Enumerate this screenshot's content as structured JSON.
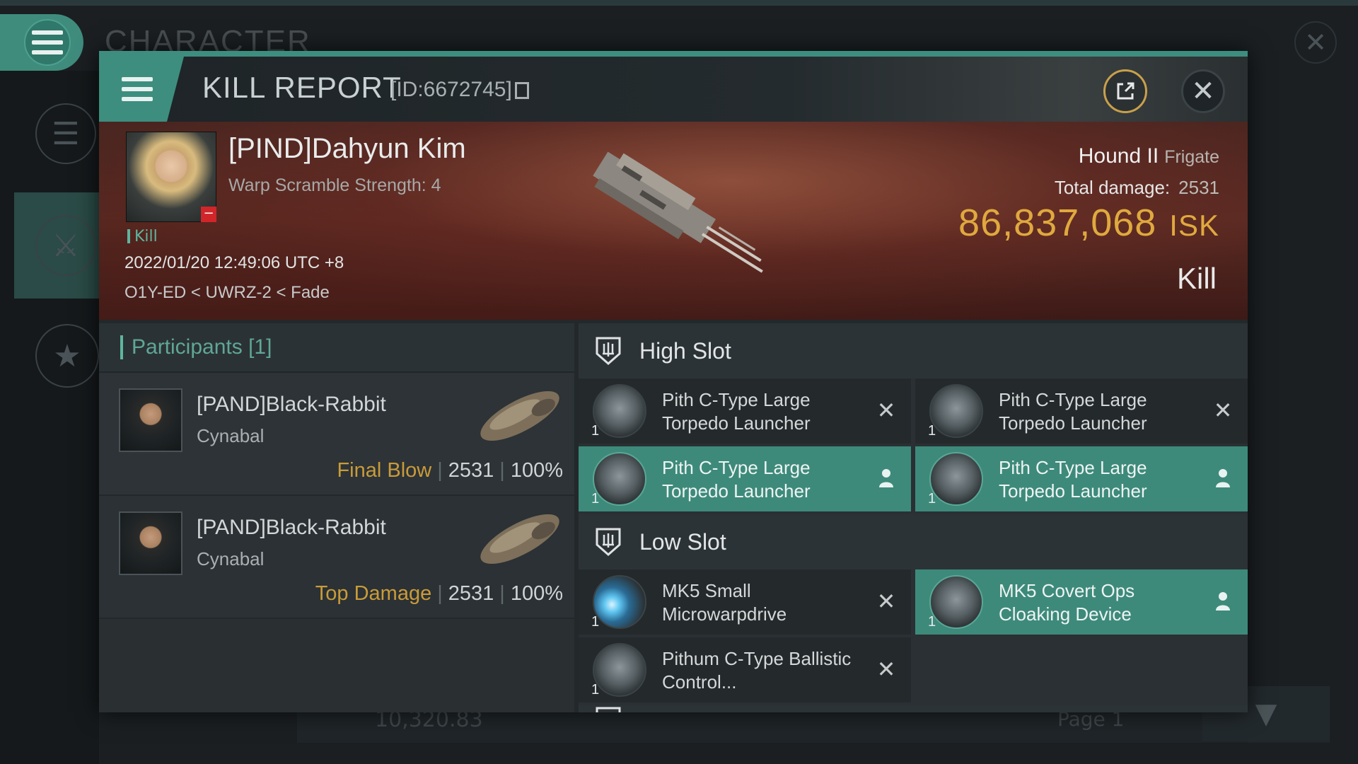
{
  "background": {
    "title": "CHARACTER",
    "bottom_value": "10,320.83",
    "page_label": "Page 1"
  },
  "modal": {
    "title": "KILL REPORT",
    "report_id": "[ID:6672745]"
  },
  "victim": {
    "name": "[PIND]Dahyun Kim",
    "subtitle": "Warp Scramble Strength: 4",
    "badge": "−",
    "kill_tag": "Kill",
    "datetime": "2022/01/20 12:49:06 UTC +8",
    "location": "O1Y-ED < UWRZ-2 < Fade",
    "ship_name": "Hound II",
    "ship_class": "Frigate",
    "total_damage_label": "Total damage:",
    "total_damage_value": "2531",
    "isk_value": "86,837,068",
    "isk_unit": "ISK",
    "result": "Kill"
  },
  "participants": {
    "header": "Participants [1]",
    "rows": [
      {
        "name": "[PAND]Black-Rabbit",
        "ship": "Cynabal",
        "role": "Final Blow",
        "damage": "2531",
        "percent": "100%"
      },
      {
        "name": "[PAND]Black-Rabbit",
        "ship": "Cynabal",
        "role": "Top Damage",
        "damage": "2531",
        "percent": "100%"
      }
    ]
  },
  "fitting": {
    "high_slot": {
      "title": "High Slot",
      "modules": [
        {
          "name": "Pith C-Type Large Torpedo Launcher",
          "qty": "1",
          "state": "destroyed"
        },
        {
          "name": "Pith C-Type Large Torpedo Launcher",
          "qty": "1",
          "state": "destroyed"
        },
        {
          "name": "Pith C-Type Large Torpedo Launcher",
          "qty": "1",
          "state": "dropped"
        },
        {
          "name": "Pith C-Type Large Torpedo Launcher",
          "qty": "1",
          "state": "dropped"
        }
      ]
    },
    "low_slot": {
      "title": "Low Slot",
      "modules": [
        {
          "name": "MK5 Small Microwarpdrive",
          "qty": "1",
          "state": "destroyed"
        },
        {
          "name": "MK5 Covert Ops Cloaking Device",
          "qty": "1",
          "state": "dropped"
        },
        {
          "name": "Pithum C-Type Ballistic Control...",
          "qty": "1",
          "state": "destroyed"
        }
      ]
    }
  },
  "colors": {
    "accent": "#3d8e7e",
    "isk": "#e0a93e",
    "role": "#c99b3a"
  }
}
